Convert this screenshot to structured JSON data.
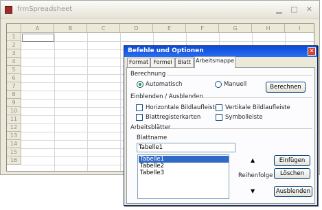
{
  "spreadsheet_window": {
    "title": "frmSpreadsheet",
    "column_headers": [
      "A",
      "B",
      "C",
      "D",
      "E",
      "F",
      "G",
      "H",
      "I"
    ],
    "row_headers": [
      "1",
      "2",
      "3",
      "4",
      "5",
      "6",
      "7",
      "8",
      "9",
      "10",
      "11",
      "12",
      "13",
      "14",
      "15",
      "16"
    ]
  },
  "dialog": {
    "title": "Befehle und Optionen",
    "close_glyph": "✕",
    "tabs": [
      "Format",
      "Formel",
      "Blatt",
      "Arbeitsmappe"
    ],
    "active_tab": "Arbeitsmappe",
    "berechnung": {
      "label": "Berechnung",
      "options": [
        "Automatisch",
        "Manuell"
      ],
      "selected": "Automatisch",
      "button": "Berechnen"
    },
    "einblenden": {
      "label": "Einblenden / Ausblenden",
      "checkboxes": [
        "Horizontale Bildlaufleiste",
        "Vertikale Bildlaufleiste",
        "Blattregisterkarten",
        "Symbolleiste"
      ]
    },
    "arbeitsblaetter": {
      "label": "Arbeitsblätter",
      "name_label": "Blattname",
      "name_value": "Tabelle1",
      "sheets": [
        "Tabelle1",
        "Tabelle2",
        "Tabelle3"
      ],
      "selected_sheet": "Tabelle1",
      "order_label": "Reihenfolge",
      "up_glyph": "▲",
      "down_glyph": "▼",
      "insert_button": "Einfügen",
      "delete_button": "Löschen",
      "hide_button": "Ausblenden"
    }
  }
}
